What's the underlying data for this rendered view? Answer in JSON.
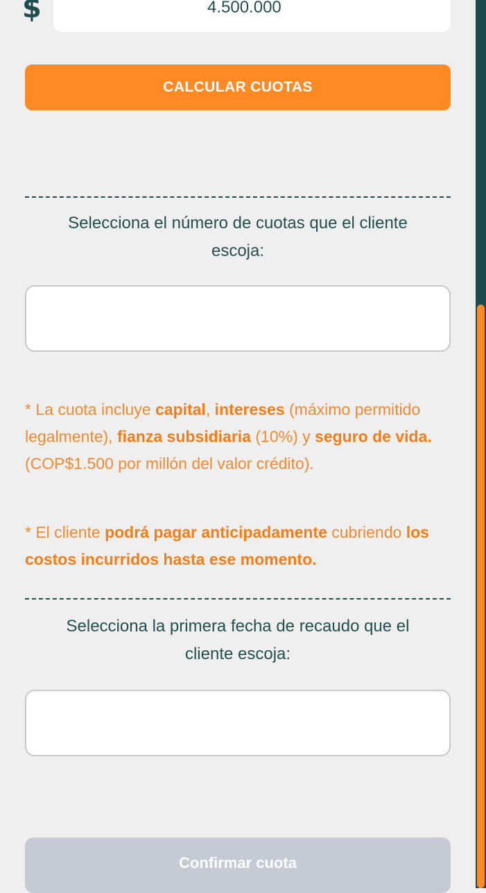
{
  "amount": {
    "currency_symbol": "$",
    "value": "4.500.000"
  },
  "calculate_button": {
    "label": "CALCULAR CUOTAS"
  },
  "installments_section": {
    "prompt_line1": "Selecciona el número de cuotas que el cliente",
    "prompt_line2": "escoja:",
    "selected_value": ""
  },
  "notes": {
    "note1": {
      "t1": "* La cuota incluye ",
      "b1": "capital",
      "t2": ", ",
      "b2": "intereses",
      "t3": " (máximo permitido legalmente), ",
      "b3": "fianza subsidiaria",
      "t4": " (10%) y ",
      "b4": "seguro de vida.",
      "t5": " (COP$1.500 por millón del valor crédito)."
    },
    "note2": {
      "t1": "* El cliente ",
      "b1": "podrá pagar anticipadamente",
      "t2": " cubriendo ",
      "b2": "los costos incurridos hasta ese momento."
    }
  },
  "date_section": {
    "prompt_line1": "Selecciona la primera fecha de recaudo que el",
    "prompt_line2": "cliente escoja:",
    "selected_value": ""
  },
  "confirm_button": {
    "label": "Confirmar cuota"
  },
  "colors": {
    "background": "#efefef",
    "primary_orange": "#fe8a25",
    "text_teal": "#1f4b4c",
    "disabled_button": "#c5cbd4",
    "scrollbar_track": "#1c4b4c"
  }
}
